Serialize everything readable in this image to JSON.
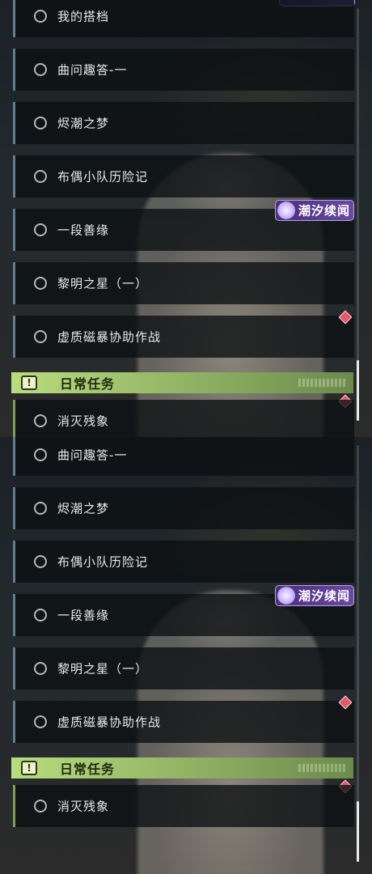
{
  "panel1": {
    "rows": [
      {
        "label": "我的搭档"
      },
      {
        "label": "曲问趣答-一"
      },
      {
        "label": "烬潮之梦"
      },
      {
        "label": "布偶小队历险记"
      },
      {
        "label": "一段善缘"
      },
      {
        "label": "黎明之星（一）"
      },
      {
        "label": "虚质磁暴协助作战"
      }
    ],
    "section_header": {
      "title": "日常任务",
      "icon": "exclamation-icon"
    },
    "partial_row": {
      "label": "消灭残象"
    },
    "tag": {
      "label": "潮汐续闻"
    }
  },
  "panel2": {
    "rows": [
      {
        "label": "曲问趣答-一"
      },
      {
        "label": "烬潮之梦"
      },
      {
        "label": "布偶小队历险记"
      },
      {
        "label": "一段善缘"
      },
      {
        "label": "黎明之星（一）"
      },
      {
        "label": "虚质磁暴协助作战"
      }
    ],
    "section_header": {
      "title": "日常任务",
      "icon": "exclamation-icon"
    },
    "daily_row": {
      "label": "消灭残象"
    },
    "tag": {
      "label": "潮汐续闻"
    }
  },
  "colors": {
    "row_accent": "#5e7f8e",
    "daily_accent": "#7ea04f",
    "header_green": "#b9dc7d",
    "tag_purple": "#6b4aa3",
    "marker_red": "#e05a6a"
  }
}
